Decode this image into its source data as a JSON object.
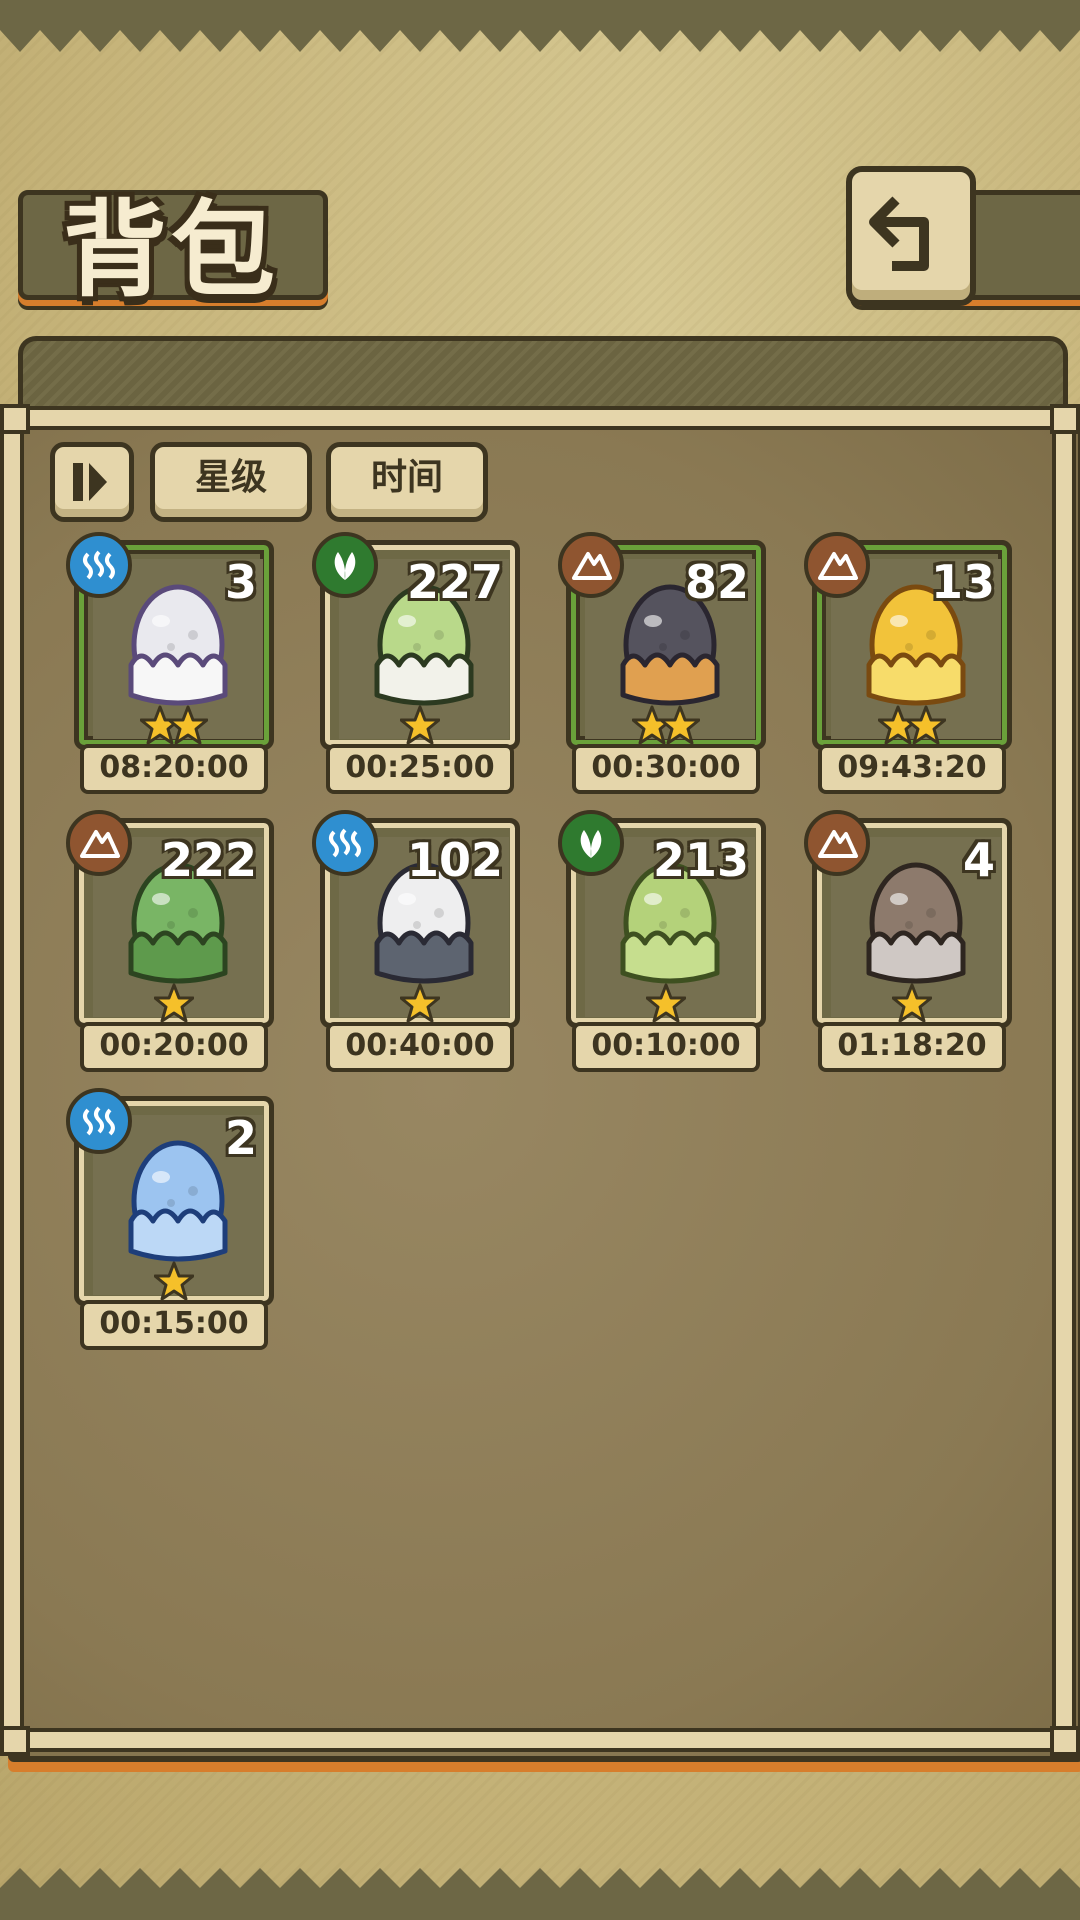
{
  "header": {
    "title": "背包",
    "back_icon": "back-arrow-icon"
  },
  "sort": {
    "toggle_icon": "sort-order-icon",
    "star_label": "星级",
    "time_label": "时间"
  },
  "colors": {
    "water": "#2f8fd0",
    "grass": "#2f7a2f",
    "earth": "#8f5530",
    "selected_border": "#6aa13a",
    "star": "#f5c02a"
  },
  "eggs": [
    {
      "count": "3",
      "time": "08:20:00",
      "element": "water",
      "stars": 2,
      "selected": true,
      "egg": "white-slime-egg"
    },
    {
      "count": "227",
      "time": "00:25:00",
      "element": "grass",
      "stars": 1,
      "selected": false,
      "egg": "sprout-egg"
    },
    {
      "count": "82",
      "time": "00:30:00",
      "element": "earth",
      "stars": 2,
      "selected": true,
      "egg": "hat-egg"
    },
    {
      "count": "13",
      "time": "09:43:20",
      "element": "earth",
      "stars": 2,
      "selected": true,
      "egg": "gold-slime-egg"
    },
    {
      "count": "222",
      "time": "00:20:00",
      "element": "earth",
      "stars": 1,
      "selected": false,
      "egg": "leaf-egg"
    },
    {
      "count": "102",
      "time": "00:40:00",
      "element": "water",
      "stars": 1,
      "selected": false,
      "egg": "striped-egg"
    },
    {
      "count": "213",
      "time": "00:10:00",
      "element": "grass",
      "stars": 1,
      "selected": false,
      "egg": "green-slime-egg"
    },
    {
      "count": "4",
      "time": "01:18:20",
      "element": "earth",
      "stars": 1,
      "selected": false,
      "egg": "chest-egg"
    },
    {
      "count": "2",
      "time": "00:15:00",
      "element": "water",
      "stars": 1,
      "selected": false,
      "egg": "blue-slime-egg"
    }
  ]
}
